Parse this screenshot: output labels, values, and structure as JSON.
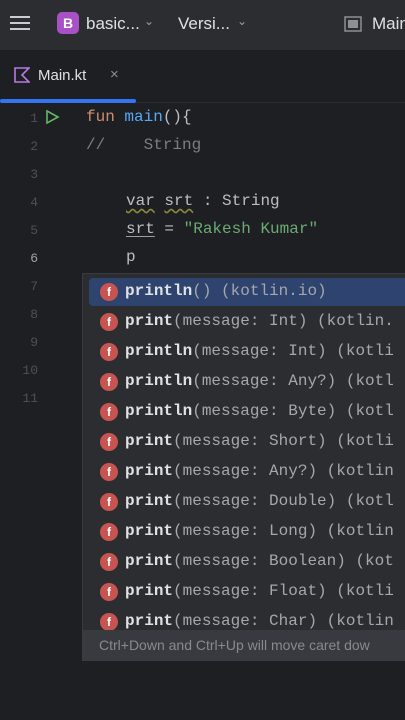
{
  "toolbar": {
    "project_badge": "B",
    "project_name": "basic...",
    "vcs_label": "Versi...",
    "run_config": "Main"
  },
  "tab": {
    "label": "Main.kt",
    "close": "×"
  },
  "line_numbers": [
    "1",
    "2",
    "3",
    "4",
    "5",
    "6",
    "7",
    "8",
    "9",
    "10",
    "11"
  ],
  "active_line": "6",
  "code": {
    "l1_kw": "fun",
    "l1_fn": "main",
    "l1_rest": "(){",
    "l2_comment": "//    String",
    "l4_kw": "var",
    "l4_var": "srt",
    "l4_rest": " : String",
    "l5_var": "srt",
    "l5_eq": " = ",
    "l5_str": "\"Rakesh Kumar\"",
    "l6_typed": "p"
  },
  "completions": [
    {
      "icon": "f",
      "match": "p",
      "name_rest": "rintln",
      "sig": "() (kotlin.io)"
    },
    {
      "icon": "f",
      "match": "p",
      "name_rest": "rint",
      "sig": "(message: Int) (kotlin."
    },
    {
      "icon": "f",
      "match": "p",
      "name_rest": "rintln",
      "sig": "(message: Int) (kotli"
    },
    {
      "icon": "f",
      "match": "p",
      "name_rest": "rintln",
      "sig": "(message: Any?) (kotl"
    },
    {
      "icon": "f",
      "match": "p",
      "name_rest": "rintln",
      "sig": "(message: Byte) (kotl"
    },
    {
      "icon": "f",
      "match": "p",
      "name_rest": "rint",
      "sig": "(message: Short) (kotli"
    },
    {
      "icon": "f",
      "match": "p",
      "name_rest": "rint",
      "sig": "(message: Any?) (kotlin"
    },
    {
      "icon": "f",
      "match": "p",
      "name_rest": "rint",
      "sig": "(message: Double) (kotl"
    },
    {
      "icon": "f",
      "match": "p",
      "name_rest": "rint",
      "sig": "(message: Long) (kotlin"
    },
    {
      "icon": "f",
      "match": "p",
      "name_rest": "rint",
      "sig": "(message: Boolean) (kot"
    },
    {
      "icon": "f",
      "match": "p",
      "name_rest": "rint",
      "sig": "(message: Float) (kotli"
    },
    {
      "icon": "f",
      "match": "p",
      "name_rest": "rint",
      "sig": "(message: Char) (kotlin"
    }
  ],
  "hint": "Ctrl+Down and Ctrl+Up will move caret dow",
  "colors": {
    "accent": "#3574f0",
    "function_icon": "#c75450",
    "selection": "#2e436e"
  }
}
